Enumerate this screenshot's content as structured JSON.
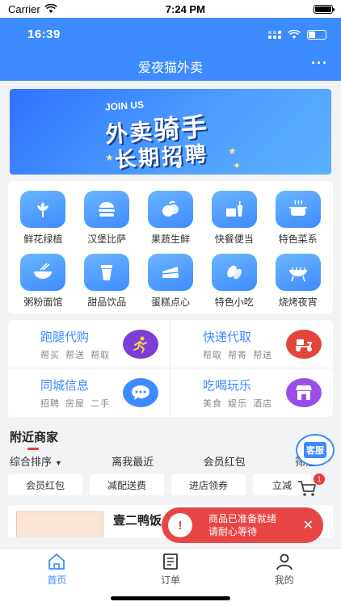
{
  "device_status": {
    "carrier": "Carrier",
    "time": "7:24 PM"
  },
  "app_status": {
    "time": "16:39"
  },
  "header": {
    "title": "爱夜猫外卖",
    "more": "···"
  },
  "banner": {
    "line_small": "JOIN US",
    "line_lead": "外卖",
    "line_big": "骑手",
    "line_bottom": "长期招聘"
  },
  "categories": [
    {
      "label": "鲜花绿植",
      "icon": "flower-icon"
    },
    {
      "label": "汉堡比萨",
      "icon": "burger-icon"
    },
    {
      "label": "果蔬生鲜",
      "icon": "fruit-icon"
    },
    {
      "label": "快餐便当",
      "icon": "fastfood-icon"
    },
    {
      "label": "特色菜系",
      "icon": "pot-icon"
    },
    {
      "label": "粥粉面馆",
      "icon": "bowl-icon"
    },
    {
      "label": "甜品饮品",
      "icon": "drink-icon"
    },
    {
      "label": "蛋糕点心",
      "icon": "cake-icon"
    },
    {
      "label": "特色小吃",
      "icon": "snack-icon"
    },
    {
      "label": "烧烤夜宵",
      "icon": "grill-icon"
    }
  ],
  "services": [
    {
      "name": "跑腿代购",
      "sub": "帮买 帮送 帮取",
      "icon": "runner-icon",
      "color": "#7b3fd6"
    },
    {
      "name": "快递代取",
      "sub": "帮取 帮寄 帮送",
      "icon": "scooter-icon",
      "color": "#e2463c"
    },
    {
      "name": "同城信息",
      "sub": "招聘 房屋 二手",
      "icon": "chat-icon",
      "color": "#3d8bff"
    },
    {
      "name": "吃喝玩乐",
      "sub": "美食 娱乐 酒店",
      "icon": "store-icon",
      "color": "#9a4ee8"
    }
  ],
  "nearby": {
    "title": "附近商家",
    "service_badge": "客服",
    "sort": [
      "综合排序",
      "离我最近",
      "会员红包",
      "筛选"
    ],
    "filters": [
      "会员红包",
      "减配送费",
      "进店领券",
      "立减"
    ],
    "cart_count": "1"
  },
  "shop": {
    "name": "壹二鸭饭"
  },
  "toast": {
    "line1": "商品已准备就绪",
    "line2": "请耐心等待",
    "close": "✕",
    "icon": "!"
  },
  "tabs": [
    {
      "label": "首页",
      "icon": "home-icon"
    },
    {
      "label": "订单",
      "icon": "order-icon"
    },
    {
      "label": "我的",
      "icon": "profile-icon"
    }
  ],
  "colors": {
    "brand": "#3d8bff",
    "alert": "#e84545"
  }
}
